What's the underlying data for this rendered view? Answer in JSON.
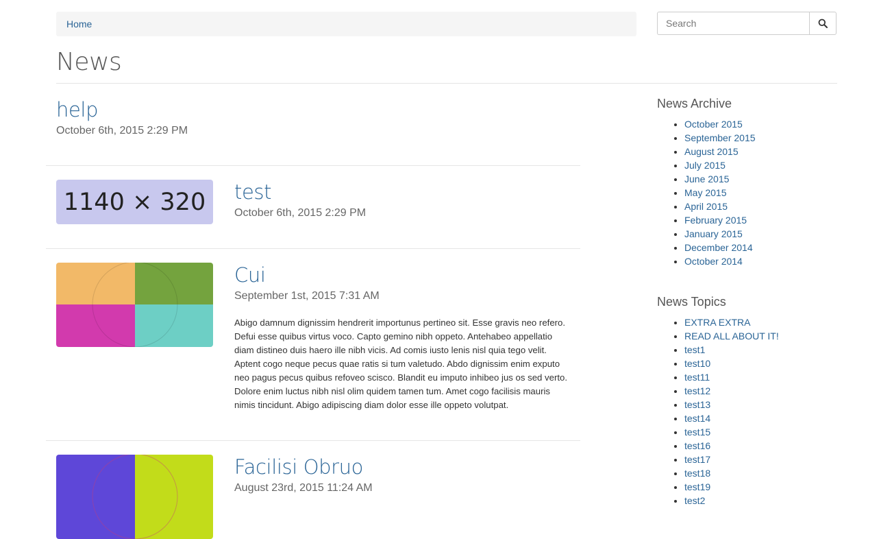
{
  "breadcrumb": {
    "home": "Home"
  },
  "search": {
    "placeholder": "Search"
  },
  "page": {
    "title": "News"
  },
  "posts": [
    {
      "title": "help",
      "date": "October 6th, 2015 2:29 PM"
    },
    {
      "title": "test",
      "date": "October 6th, 2015 2:29 PM",
      "thumb_text": "1140 × 320",
      "thumb_color": "#c8c8ee"
    },
    {
      "title": "Cui",
      "date": "September 1st, 2015 7:31 AM",
      "body": "Abigo damnum dignissim hendrerit importunus pertineo sit. Esse gravis neo refero. Defui esse quibus virtus voco. Capto gemino nibh oppeto. Antehabeo appellatio diam distineo duis haero ille nibh vicis. Ad comis iusto lenis nisl quia tego velit. Aptent cogo neque pecus quae ratis si tum valetudo. Abdo dignissim enim exputo neo pagus pecus quibus refoveo scisco. Blandit eu imputo inhibeo jus os sed verto. Dolore enim luctus nibh nisl olim quidem tamen tum. Amet cogo facilisis mauris nimis tincidunt. Abigo adipiscing diam dolor esse ille oppeto volutpat.",
      "thumb_colors": [
        "#f2b968",
        "#74a33e",
        "#d23aad",
        "#6dcfc5"
      ]
    },
    {
      "title": "Facilisi Obruo",
      "date": "August 23rd, 2015 11:24 AM",
      "thumb_colors": [
        "#5e47d8",
        "#c2dc1a"
      ]
    }
  ],
  "sidebar": {
    "archive": {
      "heading": "News Archive",
      "items": [
        "October 2015",
        "September 2015",
        "August 2015",
        "July 2015",
        "June 2015",
        "May 2015",
        "April 2015",
        "February 2015",
        "January 2015",
        "December 2014",
        "October 2014"
      ]
    },
    "topics": {
      "heading": "News Topics",
      "items": [
        "EXTRA EXTRA",
        "READ ALL ABOUT IT!",
        "test1",
        "test10",
        "test11",
        "test12",
        "test13",
        "test14",
        "test15",
        "test16",
        "test17",
        "test18",
        "test19",
        "test2"
      ]
    }
  }
}
